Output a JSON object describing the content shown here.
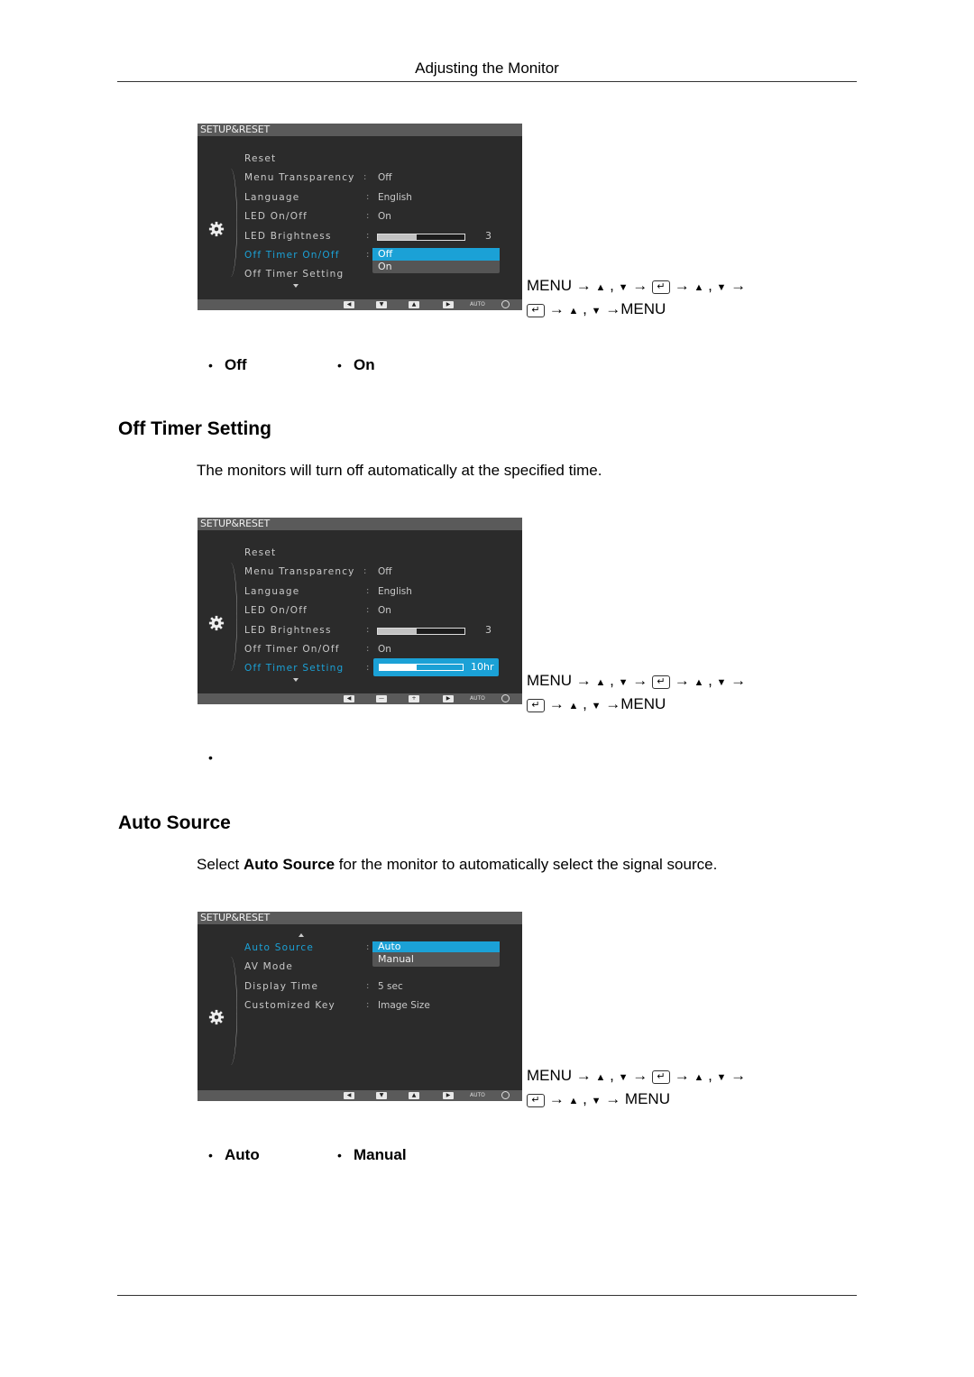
{
  "header": {
    "title": "Adjusting the Monitor"
  },
  "osd_common": {
    "title": "SETUP&RESET",
    "footer_keys": [
      "left-key",
      "down-key",
      "up-key",
      "right-key"
    ],
    "footer_auto": "AUTO"
  },
  "osd1": {
    "rows": [
      {
        "label": "Reset",
        "value": ""
      },
      {
        "label": "Menu Transparency",
        "value": "Off"
      },
      {
        "label": "Language",
        "value": "English"
      },
      {
        "label": "LED On/Off",
        "value": "On"
      },
      {
        "label": "LED Brightness",
        "value": "3",
        "level_fraction": 0.45
      },
      {
        "label": "Off Timer On/Off",
        "value": "",
        "active": true
      },
      {
        "label": "Off Timer Setting",
        "value": ""
      }
    ],
    "dropdown": {
      "options": [
        "Off",
        "On"
      ],
      "selected": "Off"
    }
  },
  "nav1": {
    "line1": [
      "MENU",
      "→",
      "▲",
      ",",
      "▼",
      "→",
      "[enter]",
      "→",
      "▲",
      ",",
      "▼",
      "→"
    ],
    "line2_end": "→MENU"
  },
  "section1_bullets": [
    "Off",
    "On"
  ],
  "section2": {
    "title": "Off Timer Setting",
    "description": "The monitors will turn off automatically at the specified time."
  },
  "osd2": {
    "rows": [
      {
        "label": "Reset",
        "value": ""
      },
      {
        "label": "Menu Transparency",
        "value": "Off"
      },
      {
        "label": "Language",
        "value": "English"
      },
      {
        "label": "LED On/Off",
        "value": "On"
      },
      {
        "label": "LED Brightness",
        "value": "3",
        "level_fraction": 0.45
      },
      {
        "label": "Off Timer On/Off",
        "value": "On"
      },
      {
        "label": "Off Timer Setting",
        "value": "10hr",
        "active": true,
        "level_fraction": 0.45
      }
    ]
  },
  "nav2": {
    "line2_end": "→MENU"
  },
  "section2_bullets": [
    ""
  ],
  "section3": {
    "title": "Auto Source",
    "description_pre": "Select ",
    "description_bold": "Auto Source",
    "description_post": " for the monitor to automatically select the signal source."
  },
  "osd3": {
    "rows": [
      {
        "label": "Auto Source",
        "value": "",
        "active": true
      },
      {
        "label": "AV Mode",
        "value": ""
      },
      {
        "label": "Display Time",
        "value": "5 sec"
      },
      {
        "label": "Customized Key",
        "value": "Image Size"
      }
    ],
    "dropdown": {
      "options": [
        "Auto",
        "Manual"
      ],
      "selected": "Auto"
    }
  },
  "nav3": {
    "line2_end": "→ MENU"
  },
  "section3_bullets": [
    "Auto",
    "Manual"
  ],
  "nav_common": {
    "menu": "MENU",
    "arrow": "→",
    "up": "▲",
    "down": "▼",
    "comma": ",",
    "enter": "↵"
  }
}
